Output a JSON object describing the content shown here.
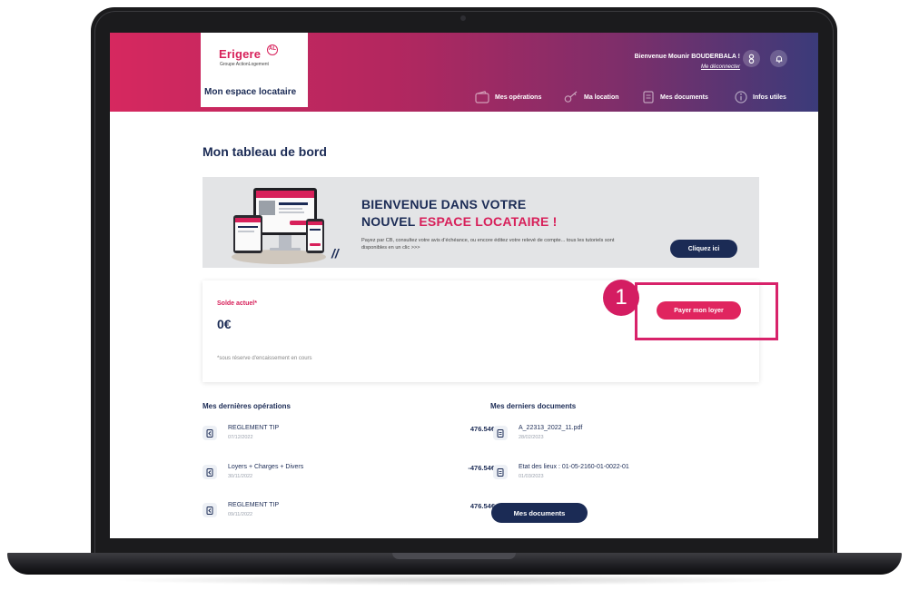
{
  "brand": {
    "name": "Erigere",
    "badge": "AL",
    "group": "Groupe ActionLogement",
    "space_title": "Mon espace locataire",
    "accent": "#d7205a",
    "navy": "#1b2b55"
  },
  "user": {
    "welcome": "Bienvenue Mounir BOUDERBALA !",
    "logout": "Me déconnecter"
  },
  "icons": {
    "account": "user-icon",
    "notifications": "bell-icon"
  },
  "nav": [
    {
      "label": "Mes opérations",
      "icon": "wallet-icon"
    },
    {
      "label": "Ma location",
      "icon": "key-icon"
    },
    {
      "label": "Mes documents",
      "icon": "document-icon"
    },
    {
      "label": "Infos utiles",
      "icon": "info-icon"
    }
  ],
  "page": {
    "title": "Mon tableau de bord"
  },
  "banner": {
    "line1": "BIENVENUE DANS VOTRE",
    "line2_prefix": "NOUVEL ",
    "line2_highlight": "ESPACE LOCATAIRE !",
    "text": "Payez par CB, consultez votre avis d'échéance, ou encore éditez votre relevé de compte... tous les tutoriels sont disponibles en un clic >>>",
    "cta": "Cliquez ici"
  },
  "balance": {
    "label": "Solde actuel*",
    "value": "0€",
    "note": "*sous réserve d'encaissement en cours",
    "pay_button": "Payer mon loyer"
  },
  "annotation": {
    "step": "1",
    "color": "#d8226a"
  },
  "operations": {
    "title": "Mes dernières opérations",
    "rows": [
      {
        "label": "REGLEMENT TIP",
        "date": "07/12/2022",
        "amount": "476.54€"
      },
      {
        "label": "Loyers + Charges + Divers",
        "date": "30/11/2022",
        "amount": "-476.54€"
      },
      {
        "label": "REGLEMENT TIP",
        "date": "09/11/2022",
        "amount": "476.54€"
      }
    ]
  },
  "documents": {
    "title": "Mes derniers documents",
    "rows": [
      {
        "label": "A_22313_2022_11.pdf",
        "date": "28/02/2023"
      },
      {
        "label": "Etat des lieux : 01-05-2160-01-0022-01",
        "date": "01/03/2023"
      }
    ],
    "button": "Mes documents"
  }
}
